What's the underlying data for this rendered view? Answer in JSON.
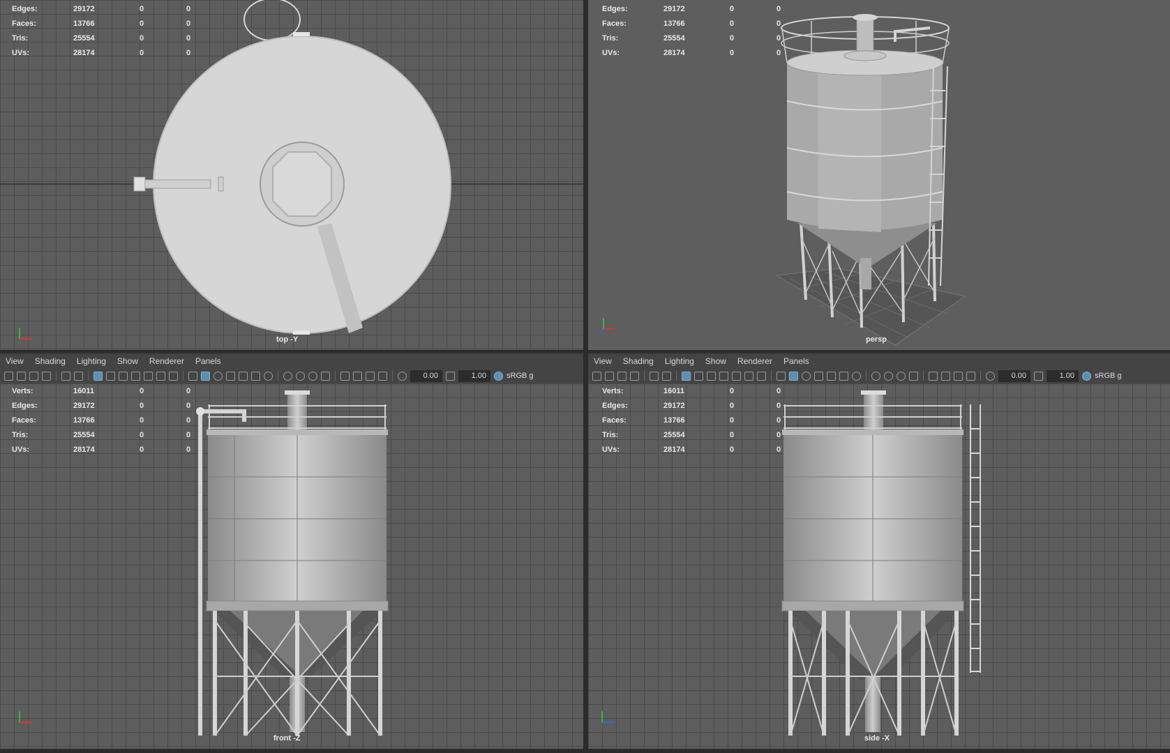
{
  "stats": [
    {
      "label": "Verts:",
      "v1": "16011",
      "v2": "0",
      "v3": "0"
    },
    {
      "label": "Edges:",
      "v1": "29172",
      "v2": "0",
      "v3": "0"
    },
    {
      "label": "Faces:",
      "v1": "13766",
      "v2": "0",
      "v3": "0"
    },
    {
      "label": "Tris:",
      "v1": "25554",
      "v2": "0",
      "v3": "0"
    },
    {
      "label": "UVs:",
      "v1": "28174",
      "v2": "0",
      "v3": "0"
    }
  ],
  "menu": {
    "view": "View",
    "shading": "Shading",
    "lighting": "Lighting",
    "show": "Show",
    "renderer": "Renderer",
    "panels": "Panels"
  },
  "toolbar": {
    "exposure": "0.00",
    "gamma": "1.00",
    "colorspace": "sRGB g"
  },
  "cameras": {
    "top": "top -Y",
    "persp": "persp",
    "front": "front -Z",
    "side": "side -X"
  },
  "axis_labels": {
    "y": "y",
    "x": "x",
    "z": "z"
  },
  "colors": {
    "viewport": "#5d5d5d",
    "grid": "#4a4a4a",
    "model": "#bdbdbd",
    "ui_bg": "#444444"
  }
}
